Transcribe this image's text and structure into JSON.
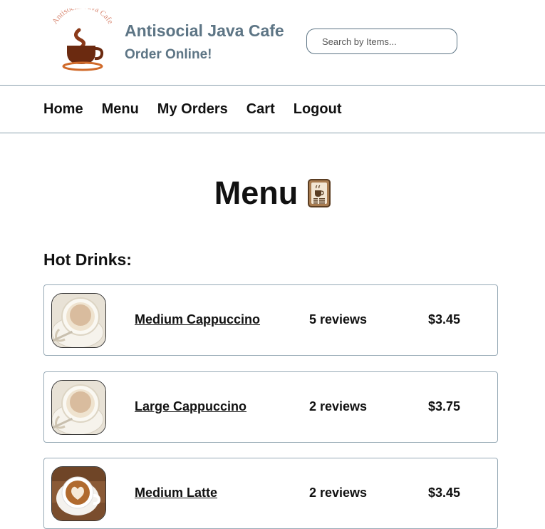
{
  "header": {
    "logo_text": "Antisocial Java Cafe",
    "title": "Antisocial Java Cafe",
    "subtitle": "Order Online!",
    "search_placeholder": "Search by Items..."
  },
  "nav": {
    "items": [
      {
        "label": "Home"
      },
      {
        "label": "Menu"
      },
      {
        "label": "My Orders"
      },
      {
        "label": "Cart"
      },
      {
        "label": "Logout"
      }
    ]
  },
  "page": {
    "title": "Menu",
    "title_icon": "menu-card-icon"
  },
  "section": {
    "title": "Hot Drinks:",
    "items": [
      {
        "name": "Medium Cappuccino",
        "reviews": "5 reviews",
        "price": "$3.45",
        "image": "cappuccino-photo"
      },
      {
        "name": "Large Cappuccino",
        "reviews": "2 reviews",
        "price": "$3.75",
        "image": "cappuccino-photo"
      },
      {
        "name": "Medium Latte",
        "reviews": "2 reviews",
        "price": "$3.45",
        "image": "latte-art-photo"
      }
    ]
  },
  "colors": {
    "brand": "#5d7585",
    "border": "#97aab6",
    "logo_accent": "#8b3a1a",
    "logo_text": "#d98a75"
  }
}
